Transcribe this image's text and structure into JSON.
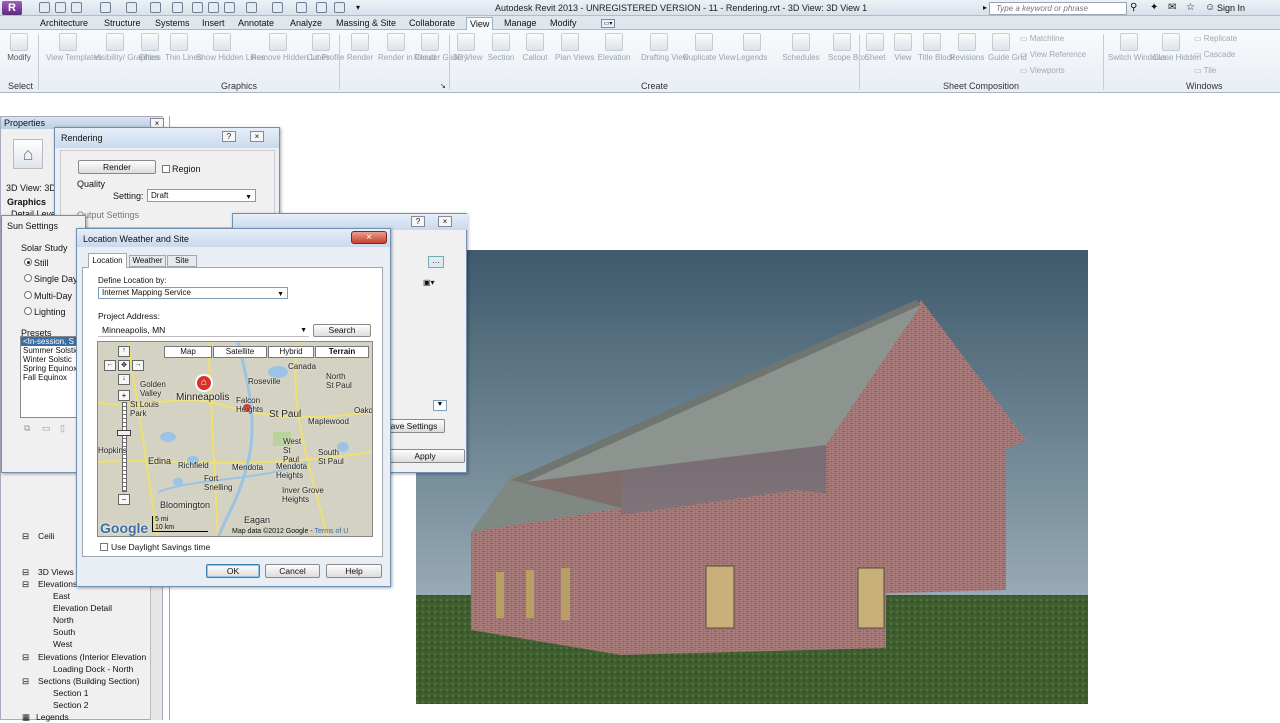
{
  "app": {
    "title": "Autodesk Revit 2013 - UNREGISTERED VERSION -   11 - Rendering.rvt - 3D View: 3D View 1",
    "search_placeholder": "Type a keyword or phrase",
    "sign_in": "Sign In"
  },
  "tabs": [
    "Architecture",
    "Structure",
    "Systems",
    "Insert",
    "Annotate",
    "Analyze",
    "Massing & Site",
    "Collaborate",
    "View",
    "Manage",
    "Modify"
  ],
  "ribbon": {
    "tools": [
      "Modify",
      "View Templates",
      "Visibility/ Graphics",
      "Filters",
      "Thin Lines",
      "Show Hidden Lines",
      "Remove Hidden Lines",
      "Cut Profile",
      "Render",
      "Render in Cloud",
      "Render Gallery",
      "3D View",
      "Section",
      "Callout",
      "Plan Views",
      "Elevation",
      "Drafting View",
      "Duplicate View",
      "Legends",
      "Schedules",
      "Scope Box",
      "Sheet",
      "View",
      "Title Block",
      "Revisions",
      "Guide Grid",
      "Switch Windows",
      "Close Hidden"
    ],
    "small_tools": [
      "Matchline",
      "View Reference",
      "Viewports",
      "Replicate",
      "Cascade",
      "Tile"
    ],
    "panels": [
      "Select",
      "Graphics",
      "Create",
      "Sheet Composition",
      "Windows"
    ]
  },
  "properties": {
    "title": "Properties",
    "view_label": "3D View: 3D",
    "graphics": "Graphics",
    "detail": "Detail Level"
  },
  "tree": [
    "Ceili",
    "3D Views",
    "Elevations",
    "East",
    "Elevation Detail",
    "North",
    "South",
    "West",
    "Elevations (Interior Elevation",
    "Loading Dock - North",
    "Sections (Building Section)",
    "Section 1",
    "Section 2",
    "Legends"
  ],
  "rendering": {
    "title": "Rendering",
    "render_btn": "Render",
    "region": "Region",
    "quality": "Quality",
    "setting_label": "Setting:",
    "setting_value": "Draft",
    "output": "Output Settings"
  },
  "sun": {
    "title": "Sun Settings",
    "solar_study": "Solar Study",
    "options": [
      "Still",
      "Single Day",
      "Multi-Day",
      "Lighting"
    ],
    "presets": "Presets",
    "preset_items": [
      "<In-session, S",
      "Summer Solstic",
      "Winter Solstic",
      "Spring Equinox",
      "Fall Equinox"
    ]
  },
  "back_dialog": {
    "save_settings": "ave Settings",
    "apply": "Apply"
  },
  "location": {
    "title": "Location Weather and Site",
    "tabs": [
      "Location",
      "Weather",
      "Site"
    ],
    "define_by_label": "Define Location by:",
    "define_by_value": "Internet Mapping Service",
    "project_address_label": "Project Address:",
    "project_address_value": "Minneapolis, MN",
    "search_btn": "Search",
    "map_tabs": [
      "Map",
      "Satellite",
      "Hybrid",
      "Terrain"
    ],
    "map_labels": [
      "Minneapolis",
      "St Paul",
      "Roseville",
      "Golden Valley",
      "St Louis Park",
      "Edina",
      "Richfield",
      "Bloomington",
      "Eagan",
      "Maplewood",
      "Mendota Heights",
      "Inver Grove Heights",
      "South St Paul",
      "West St Paul",
      "Fort Snelling",
      "North St Paul",
      "Falcon Heights",
      "Canada",
      "Oakd",
      "Mendota",
      "Hopkins"
    ],
    "map_footer": "Map data ©2012 Google -",
    "map_terms": "Terms of U",
    "scale_mi": "5 mi",
    "scale_km": "10 km",
    "google": "Google",
    "daylight": "Use Daylight Savings time",
    "ok": "OK",
    "cancel": "Cancel",
    "help": "Help"
  },
  "colors": {
    "accent": "#3a6ea5",
    "marker": "#d9302a",
    "roof": "#8c948d",
    "brick": "#a0716e",
    "grass": "#4a6a35"
  }
}
